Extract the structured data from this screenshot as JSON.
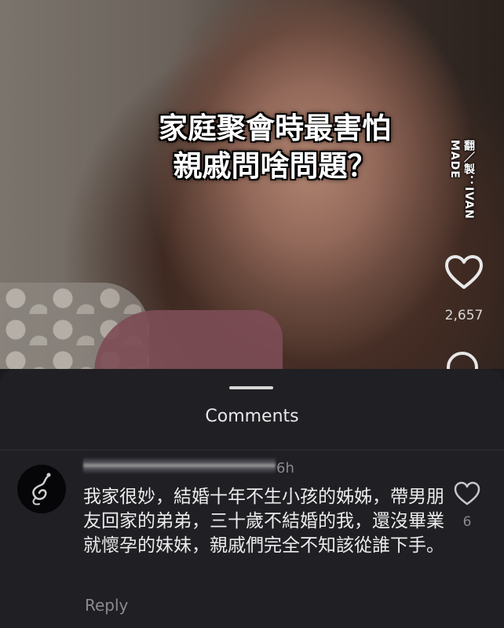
{
  "video": {
    "caption_line1": "家庭聚會時最害怕",
    "caption_line2": "親戚問啥問題？",
    "credit": "翻／製：IVAN MADE",
    "like_icon": "heart-outline-icon",
    "like_count": "2,657",
    "next_icon": "circle-icon"
  },
  "comments_sheet": {
    "title": "Comments",
    "comment": {
      "avatar_icon": "snake-avatar",
      "username": "redacted",
      "time": "6h",
      "text": "我家很妙，結婚十年不生小孩的姊姊，帶男朋友回家的弟弟，三十歲不結婚的我，還沒畢業就懷孕的妹妹，親戚們完全不知該從誰下手。",
      "like_icon": "heart-outline-icon",
      "like_count": "6",
      "reply_label": "Reply"
    }
  },
  "colors": {
    "sheet_bg": "#1f1f24",
    "text_primary": "#ececec",
    "text_secondary": "#8a8a90"
  }
}
